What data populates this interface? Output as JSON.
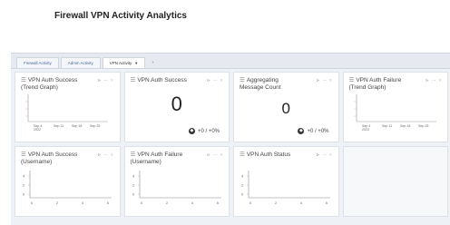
{
  "page": {
    "title": "Firewall VPN Activity Analytics"
  },
  "tabs": [
    {
      "label": "Firewall Activity"
    },
    {
      "label": "Admin Activity"
    },
    {
      "label": "VPN Activity",
      "active": true
    }
  ],
  "tab_add_label": "+",
  "cards": [
    {
      "title": "VPN Auth Success (Trend Graph)",
      "kind": "trend",
      "x_ticks": [
        "Sep 4 2022",
        "Sep 11",
        "Sep 18",
        "Sep 25"
      ]
    },
    {
      "title": "VPN Auth Success",
      "kind": "number",
      "value": "0",
      "delta": "+0 / +0%"
    },
    {
      "title": "Aggregating Message Count",
      "kind": "number",
      "value": "0",
      "delta": "+0 / +0%"
    },
    {
      "title": "VPN Auth Failure (Trend Graph)",
      "kind": "trend",
      "x_ticks": [
        "Sep 4 2022",
        "Sep 11",
        "Sep 18",
        "Sep 25"
      ]
    },
    {
      "title": "VPN Auth Success (Username)",
      "kind": "bar",
      "y_ticks": [
        "4",
        "2",
        "0"
      ],
      "x_ticks": [
        "0",
        "2",
        "4",
        "6"
      ]
    },
    {
      "title": "VPN Auth Failure (Username)",
      "kind": "bar",
      "y_ticks": [
        "4",
        "2",
        "0"
      ],
      "x_ticks": [
        "0",
        "2",
        "4",
        "6"
      ]
    },
    {
      "title": "VPN Auth Status",
      "kind": "bar",
      "y_ticks": [
        "4",
        "2",
        "0"
      ],
      "x_ticks": [
        "0",
        "2",
        "4",
        "6"
      ]
    }
  ],
  "card_tool_glyphs": "⊳ ⋯ ▿",
  "menu_glyph": "☰",
  "colors": {
    "accent": "#4a6a9a",
    "border": "#dde2e8",
    "background": "#eef1f5"
  }
}
